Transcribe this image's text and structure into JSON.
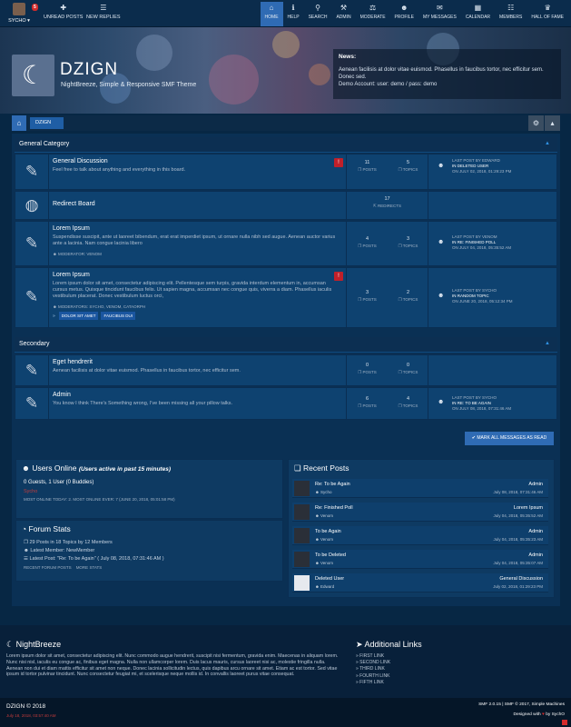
{
  "topbar": {
    "user": {
      "name": "SYCHO",
      "notif_count": "5"
    },
    "quick": [
      {
        "icon": "unread-icon",
        "label": "UNREAD POSTS"
      },
      {
        "icon": "new-replies-icon",
        "label": "NEW REPLIES"
      }
    ],
    "menu": [
      {
        "label": "HOME",
        "icon": "home-icon",
        "glyph": "⌂",
        "active": true
      },
      {
        "label": "HELP",
        "icon": "info-icon",
        "glyph": "ℹ"
      },
      {
        "label": "SEARCH",
        "icon": "search-icon",
        "glyph": "⚲"
      },
      {
        "label": "ADMIN",
        "icon": "wrench-icon",
        "glyph": "⚒"
      },
      {
        "label": "MODERATE",
        "icon": "gavel-icon",
        "glyph": "⚖"
      },
      {
        "label": "PROFILE",
        "icon": "user-icon",
        "glyph": "☻"
      },
      {
        "label": "MY MESSAGES",
        "icon": "envelope-icon",
        "glyph": "✉"
      },
      {
        "label": "CALENDAR",
        "icon": "calendar-icon",
        "glyph": "▦"
      },
      {
        "label": "MEMBERS",
        "icon": "members-icon",
        "glyph": "☷"
      },
      {
        "label": "HALL OF FAME",
        "icon": "trophy-icon",
        "glyph": "♛"
      }
    ]
  },
  "header": {
    "site_name": "DZIGN",
    "slogan": "NightBreeze, Simple & Responsive SMF Theme"
  },
  "news": {
    "title": "News:",
    "text": "Aenean facilisis at dolor vitae euismod. Phasellus in faucibus tortor, nec efficitur sem. Donec sed.",
    "account": "Demo Account: user: demo / pass: demo"
  },
  "breadcrumb": {
    "current": "DZIGN"
  },
  "categories": [
    {
      "title": "General Category"
    },
    {
      "title": "Secondary"
    }
  ],
  "boards": [
    {
      "name": "General Discussion",
      "desc": "Feel free to talk about anything and everything in this board.",
      "posts": "11",
      "posts_label": "POSTS",
      "topics": "5",
      "topics_label": "TOPICS",
      "last_by": "LAST POST BY EDWARD",
      "last_in": "IN DELETED USER",
      "last_date": "ON JULY 02, 2018, 01:29:23 PM"
    },
    {
      "name": "Redirect Board",
      "redirects": "17",
      "redirects_label": "REDIRECTS"
    },
    {
      "name": "Lorem Ipsum",
      "desc": "Suspendisse suscipit, ante ut laoreet bibendum, erat erat imperdiet ipsum, ut ornare nulla nibh sed augue. Aenean auctor varius ante a lacinia. Nam congue lacinia libero",
      "mod": "MODERATOR: VENOM",
      "posts": "4",
      "posts_label": "POSTS",
      "topics": "3",
      "topics_label": "TOPICS",
      "last_by": "LAST POST BY VENOM",
      "last_in": "IN RE: FINISHED POLL",
      "last_date": "ON JULY 04, 2018, 05:35:52 AM"
    },
    {
      "name": "Lorem Ipsum",
      "desc": "Lorem ipsum dolor sit amet, consectetur adipiscing elit. Pellentesque sem turpis, gravida interdum elementum in, accumsan cursus metus. Quisque tincidunt faucibus felis. Ut sapien magna, accumsan nec congue quis, viverra a diam. Phasellus iaculis vestibulum placerat. Donec vestibulum luctus orci,",
      "mod": "MODERATORS: SYCHO, VENOM, CATAORPH",
      "subboards": [
        "DOLOR SIT AMET",
        "FAUCIBUS DUI"
      ],
      "posts": "3",
      "posts_label": "POSTS",
      "topics": "2",
      "topics_label": "TOPICS",
      "last_by": "LAST POST BY SYCHO",
      "last_in": "IN RANDOM TOPIC",
      "last_date": "ON JUNE 20, 2018, 05:12:34 PM"
    },
    {
      "name": "Eget hendrerit",
      "desc": "Aenean facilisis at dolor vitae euismod. Phasellus in faucibus tortor, nec efficitur sem.",
      "posts": "0",
      "posts_label": "POSTS",
      "topics": "0",
      "topics_label": "TOPICS"
    },
    {
      "name": "Admin",
      "desc": "You know I think There's Something wrong, I've been missing all your pillow talks.",
      "posts": "6",
      "posts_label": "POSTS",
      "topics": "4",
      "topics_label": "TOPICS",
      "last_by": "LAST POST BY SYCHO",
      "last_in": "IN RE: TO BE AGAIN",
      "last_date": "ON JULY 08, 2018, 07:31:46 AM"
    }
  ],
  "mark_read": "MARK ALL MESSAGES AS READ",
  "users_online": {
    "title": "Users Online",
    "subtitle": "(Users active in past 15 minutes)",
    "count": "0 Guests, 1 User (0 Buddies)",
    "user": "Sycho",
    "most": "MOST ONLINE TODAY: 2. MOST ONLINE EVER: 7 (JUNE 20, 2018, 05:01:58 PM)"
  },
  "forum_stats": {
    "title": "Forum Stats",
    "line1": "29 Posts in 18 Topics by 12 Members",
    "line2": "Latest Member: NewMember",
    "line3": "Latest Post: \"Re: To be Again\" ( July 08, 2018, 07:31:46 AM )",
    "link1": "RECENT FORUM POSTS",
    "link2": "MORE STATS"
  },
  "recent_posts": {
    "title": "Recent Posts",
    "items": [
      {
        "title": "Re: To be Again",
        "author": "Sycho",
        "board": "Admin",
        "date": "July 08, 2018, 07:31:46 AM"
      },
      {
        "title": "Re: Finished Poll",
        "author": "Venom",
        "board": "Lorem Ipsum",
        "date": "July 04, 2018, 05:35:52 AM"
      },
      {
        "title": "To be Again",
        "author": "Venom",
        "board": "Admin",
        "date": "July 04, 2018, 05:35:23 AM"
      },
      {
        "title": "To be Deleted",
        "author": "Venom",
        "board": "Admin",
        "date": "July 04, 2018, 05:35:07 AM"
      },
      {
        "title": "Deleted User",
        "author": "Edward",
        "board": "General Discussion",
        "date": "July 02, 2018, 01:29:23 PM"
      }
    ]
  },
  "footer": {
    "title": "NightBreeze",
    "text": "Lorem ipsum dolor sit amet, consectetur adipiscing elit. Nunc commodo augue hendrerit, suscipit nisi fermentum, gravida enim. Maecenas in aliquam lorem. Nunc nisi nisl, iaculis eu congue ac, finibus eget magna. Nulla non ullamcorper lorem. Duis lacus mauris, cursus laoreet nisi ac, molestie fringilla nulla. Aenean non dui et diam mattis efficitur sit amet non neque. Donec lacinia sollicitudin lectus, quis dapibus arcu ornare sit amet. Etiam ac est tortor. Sed vitae ipsum id tortor pulvinar tincidunt. Nunc consectetur feugiat mi, et scelerisque neque mollis id. In convallis laoreet purus vitae consequat.",
    "links_title": "Additional Links",
    "links": [
      "FIRST LINK",
      "SECOND LINK",
      "THIRD LINK",
      "FOURTH LINK",
      "FIFTH LINK"
    ],
    "copyright": "DZIGN © 2018",
    "time": "July 18, 2018, 03:57:40 AM",
    "smf": "SMF 2.0.15 | SMF © 2017, Simple Machines",
    "designed": "Designed with",
    "designer": "by SychO"
  }
}
